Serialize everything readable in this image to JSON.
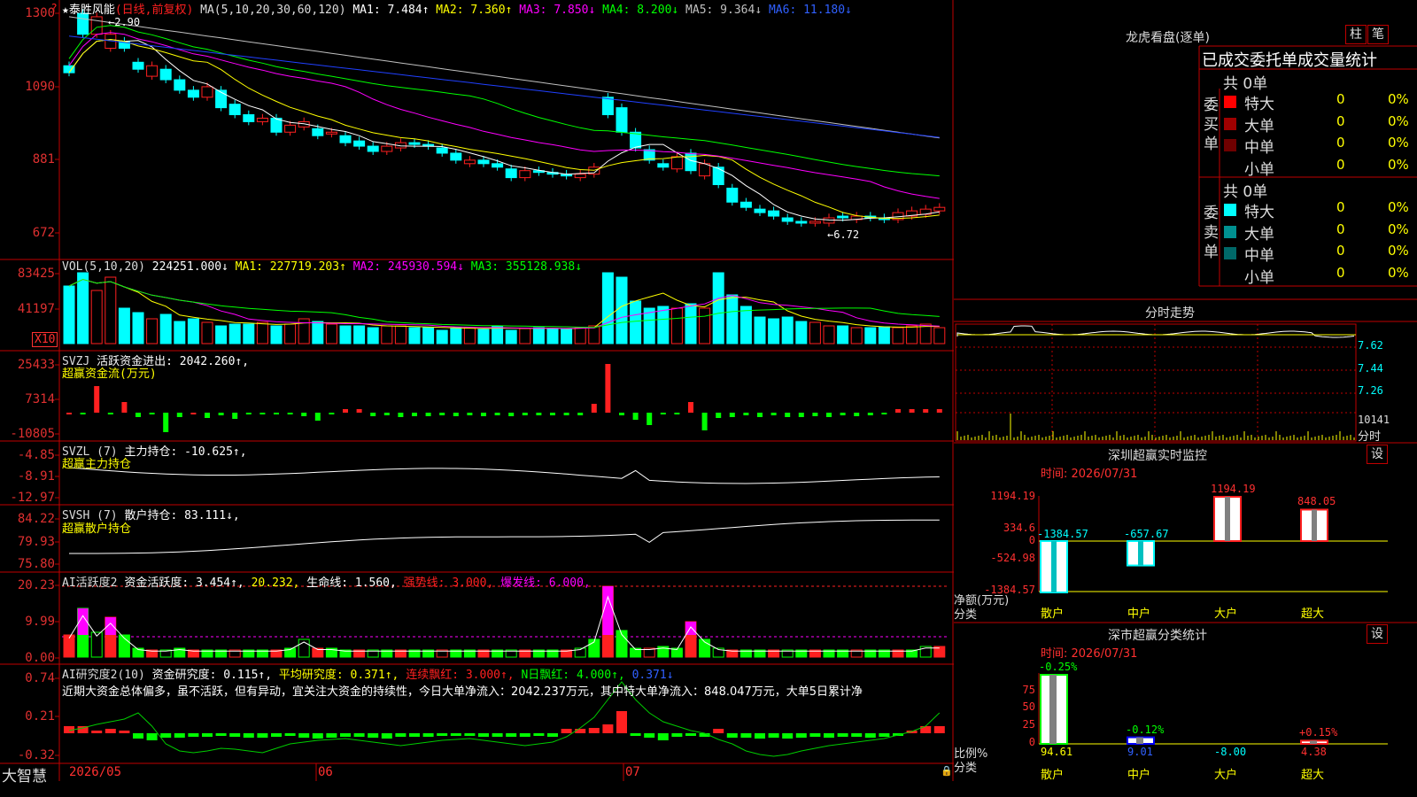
{
  "colors": {
    "up": "#ff2020",
    "down": "#00ffff",
    "ma1": "#ffffff",
    "ma2": "#ffff00",
    "ma3": "#ff00ff",
    "ma4": "#00ff00",
    "ma5": "#c0c0c0",
    "ma6": "#0000ff",
    "grid": "#c00000"
  },
  "main_header": {
    "star": "★",
    "name": "泰胜风能",
    "period": "(日线,前复权)",
    "ma_label": "MA(5,10,20,30,60,120)",
    "ma1": "MA1: 7.484↑",
    "ma2": "MA2: 7.360↑",
    "ma3": "MA3: 7.850↓",
    "ma4": "MA4: 8.200↓",
    "ma5": "MA5: 9.364↓",
    "ma6": "MA6: 11.180↓"
  },
  "price_axis": [
    "1300",
    "1090",
    "881",
    "672"
  ],
  "price_marks": {
    "high": "2.90",
    "low": "←6.72",
    "high_arrow": "←"
  },
  "vol_header": {
    "label": "VOL(5,10,20)",
    "value": "224251.000↓",
    "ma1": "MA1: 227719.203↑",
    "ma2": "MA2: 245930.594↓",
    "ma3": "MA3: 355128.938↓"
  },
  "vol_axis": [
    "83425",
    "41197"
  ],
  "vol_unit": "X10",
  "svzj": {
    "label": "SVZJ",
    "name": "活跃资金进出: 2042.260↑,",
    "sub": "超赢资金流(万元)",
    "axis": [
      "25433",
      "7314",
      "-10805"
    ]
  },
  "svzl": {
    "label": "SVZL (7)",
    "name": "主力持仓: -10.625↑,",
    "sub": "超赢主力持仓",
    "axis": [
      "-4.85",
      "-8.91",
      "-12.97"
    ]
  },
  "svsh": {
    "label": "SVSH (7)",
    "name": "散户持仓: 83.111↓,",
    "sub": "超赢散户持仓",
    "axis": [
      "84.22",
      "79.93",
      "75.80"
    ]
  },
  "ai1": {
    "label": "AI活跃度2",
    "name": "资金活跃度: 3.454↑,",
    "v2": "20.232,",
    "life": "生命线: 1.560,",
    "strong": "强势线: 3.000,",
    "burst": "爆发线: 6.000,",
    "axis": [
      "20.23",
      "9.99",
      "0.00"
    ]
  },
  "ai2": {
    "label": "AI研究度2(10)",
    "name": "资金研究度: 0.115↑,",
    "avg": "平均研究度: 0.371↑,",
    "cont": "连续飘红: 3.000↑,",
    "nred": "N日飘红: 4.000↑,",
    "val": "0.371↓",
    "axis": [
      "0.74",
      "0.21",
      "-0.32"
    ],
    "comment": "近期大资金总体偏多，虽不活跃，但有异动，宜关注大资金的持续性，今日大单净流入：2042.237万元，其中特大单净流入：848.047万元，大单5日累计净"
  },
  "x_axis": {
    "app": "大智慧",
    "dates": [
      "2026/05",
      "06",
      "07"
    ]
  },
  "right": {
    "lhb_title": "龙虎看盘(逐单)",
    "btn1": "柱",
    "btn2": "笔",
    "stat_title": "已成交委托单成交量统计",
    "buy": {
      "side": "委买单",
      "total": "共 0单",
      "rows": [
        {
          "name": "特大",
          "v": "0",
          "p": "0%",
          "c": "#ff0000"
        },
        {
          "name": "大单",
          "v": "0",
          "p": "0%",
          "c": "#a00000"
        },
        {
          "name": "中单",
          "v": "0",
          "p": "0%",
          "c": "#700000"
        },
        {
          "name": "小单",
          "v": "0",
          "p": "0%",
          "c": "#000000"
        }
      ]
    },
    "sell": {
      "side": "委卖单",
      "total": "共 0单",
      "rows": [
        {
          "name": "特大",
          "v": "0",
          "p": "0%",
          "c": "#00ffff"
        },
        {
          "name": "大单",
          "v": "0",
          "p": "0%",
          "c": "#009090"
        },
        {
          "name": "中单",
          "v": "0",
          "p": "0%",
          "c": "#006868"
        },
        {
          "name": "小单",
          "v": "0",
          "p": "0%",
          "c": "#000000"
        }
      ]
    },
    "fs_title": "分时走势",
    "fs_axis": [
      "7.62",
      "7.44",
      "7.26"
    ],
    "fs_vol": "10141",
    "fs_unit": "分时",
    "mon_title": "深圳超赢实时监控",
    "mon_btn": "设",
    "mon_time": "时间: 2026/07/31",
    "mon_axis": [
      "1194.19",
      "334.6",
      "0",
      "-524.98",
      "-1384.57"
    ],
    "mon_bars": [
      {
        "label": "散户",
        "value": -1384.57,
        "text": "-1384.57"
      },
      {
        "label": "中户",
        "value": -657.67,
        "text": "-657.67"
      },
      {
        "label": "大户",
        "value": 1194.19,
        "text": "1194.19"
      },
      {
        "label": "超大",
        "value": 848.05,
        "text": "848.05"
      }
    ],
    "mon_unit": "净额(万元)",
    "mon_cat": "分类",
    "cls_title": "深市超赢分类统计",
    "cls_btn": "设",
    "cls_time": "时间: 2026/07/31",
    "cls_axis": [
      "75",
      "50",
      "25",
      "0"
    ],
    "cls_bars": [
      {
        "label": "散户",
        "value": 94.61,
        "chg": "-0.25%",
        "text": "94.61"
      },
      {
        "label": "中户",
        "value": 9.01,
        "chg": "-0.12%",
        "text": "9.01"
      },
      {
        "label": "大户",
        "value": -8.0,
        "chg": "",
        "text": "-8.00"
      },
      {
        "label": "超大",
        "value": 4.38,
        "chg": "+0.15%",
        "text": "4.38"
      }
    ],
    "cls_unit": "比例%",
    "cls_cat": "分类"
  }
}
